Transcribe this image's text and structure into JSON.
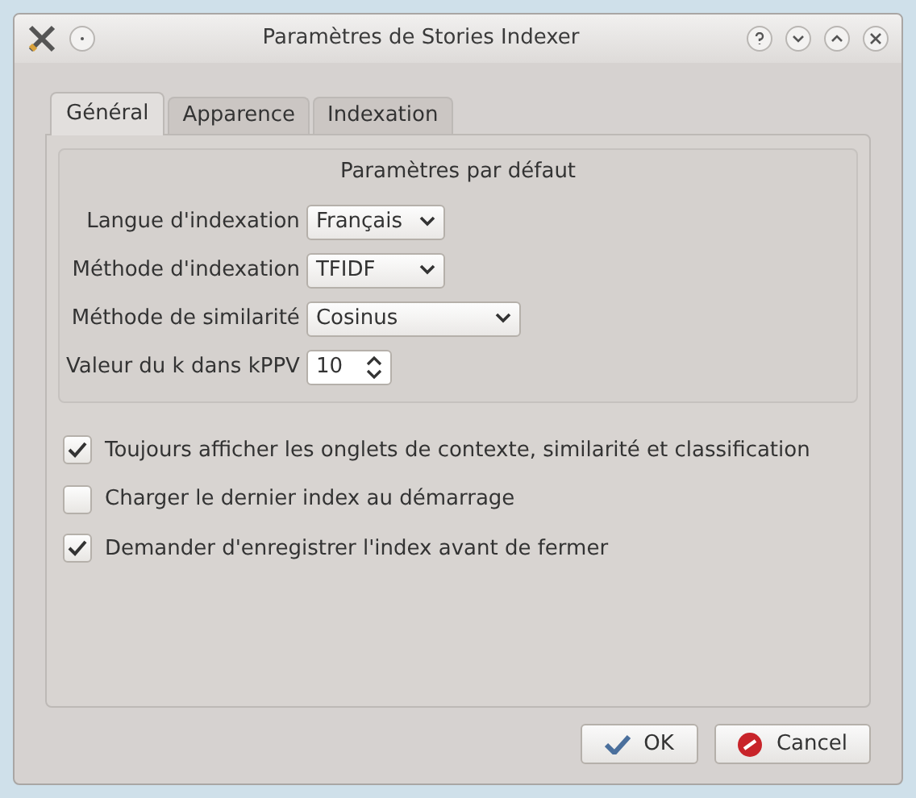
{
  "window": {
    "title": "Paramètres de Stories Indexer"
  },
  "tabs": [
    {
      "label": "Général",
      "selected": true
    },
    {
      "label": "Apparence",
      "selected": false
    },
    {
      "label": "Indexation",
      "selected": false
    }
  ],
  "group": {
    "title": "Paramètres par défaut",
    "fields": [
      {
        "label": "Langue d'indexation",
        "kind": "select",
        "value": "Français"
      },
      {
        "label": "Méthode d'indexation",
        "kind": "select",
        "value": "TFIDF"
      },
      {
        "label": "Méthode de similarité",
        "kind": "select",
        "value": "Cosinus"
      },
      {
        "label": "Valeur du k dans kPPV",
        "kind": "spinbox",
        "value": "10"
      }
    ]
  },
  "checkboxes": [
    {
      "label": "Toujours afficher les onglets de contexte, similarité et classification",
      "checked": true
    },
    {
      "label": "Charger le dernier index au démarrage",
      "checked": false
    },
    {
      "label": "Demander d'enregistrer l'index avant de fermer",
      "checked": true
    }
  ],
  "buttons": [
    {
      "label": "OK",
      "kind": "ok"
    },
    {
      "label": "Cancel",
      "kind": "cancel"
    }
  ]
}
